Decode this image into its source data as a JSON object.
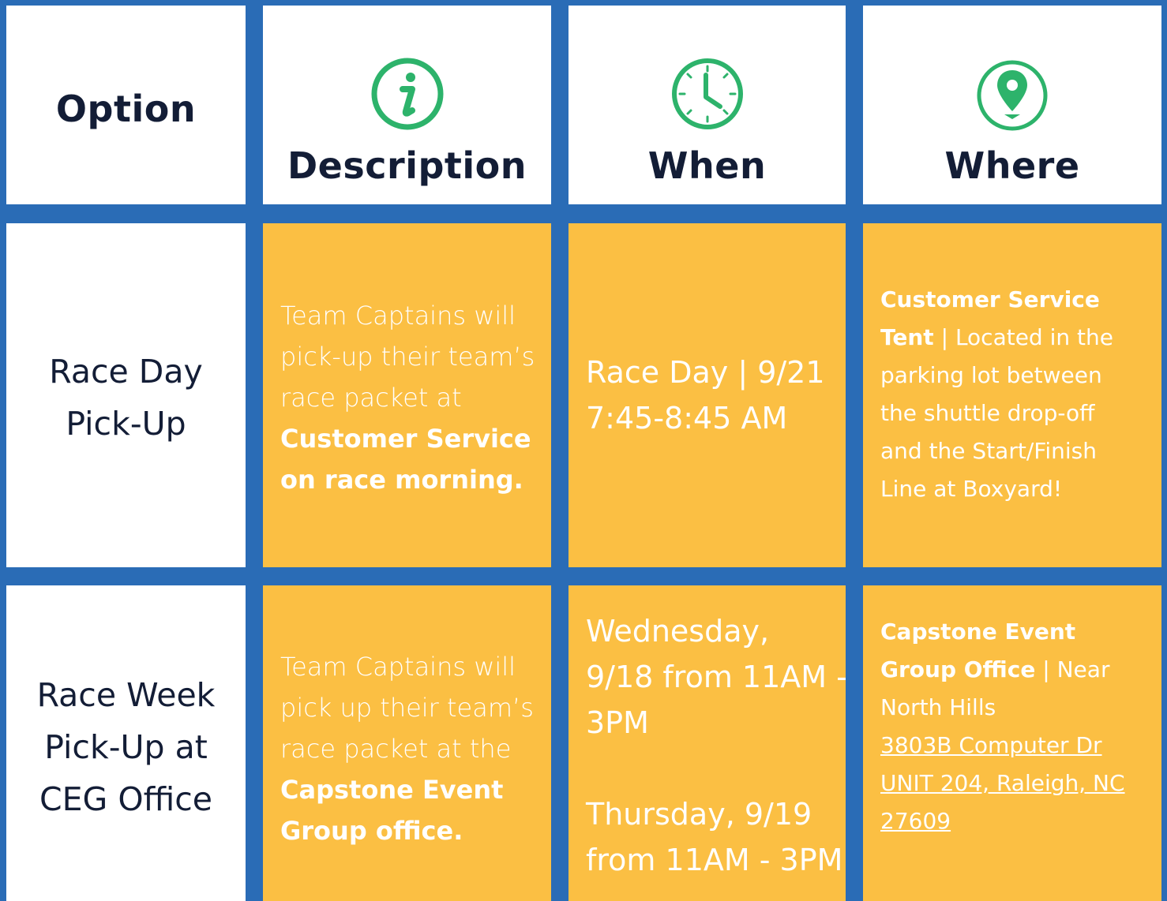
{
  "header": {
    "option": "Option",
    "description": "Description",
    "when": "When",
    "where": "Where",
    "icons": {
      "description": "info-icon",
      "when": "clock-icon",
      "where": "location-pin-icon"
    },
    "icon_color": "#2db36b"
  },
  "colors": {
    "background": "#2a6cb6",
    "header_cell": "#ffffff",
    "content_cell": "#fbbf43",
    "text_dark": "#131d36"
  },
  "rows": [
    {
      "option": [
        "Race Day",
        "Pick-Up"
      ],
      "description": {
        "plain": [
          "Team Captains will",
          "pick-up their team’s",
          "race packet at"
        ],
        "bold": [
          "Customer Service",
          "on race morning."
        ]
      },
      "when": [
        "Race Day | 9/21",
        "7:45-8:45 AM"
      ],
      "where": {
        "bold_1": "Customer Service",
        "bold_2": "Tent",
        "rest_1": " | Located in the",
        "lines": [
          "parking lot between",
          "the shuttle drop-off",
          "and the Start/Finish",
          "Line at Boxyard!"
        ]
      }
    },
    {
      "option": [
        "Race Week",
        "Pick-Up at",
        "CEG Office"
      ],
      "description": {
        "plain": [
          "Team Captains will",
          "pick up their team’s",
          "race packet at the"
        ],
        "bold": [
          "Capstone Event",
          "Group office."
        ]
      },
      "when": [
        "Wednesday,",
        "9/18 from 11AM -",
        "3PM",
        "Thursday, 9/19",
        "from 11AM - 3PM"
      ],
      "where": {
        "bold_1": "Capstone Event",
        "bold_2": "Group Office",
        "rest_1": "  | Near",
        "line_2": "North Hills",
        "address": [
          "3803B Computer Dr",
          "UNIT 204, Raleigh, NC",
          "27609"
        ]
      }
    }
  ]
}
